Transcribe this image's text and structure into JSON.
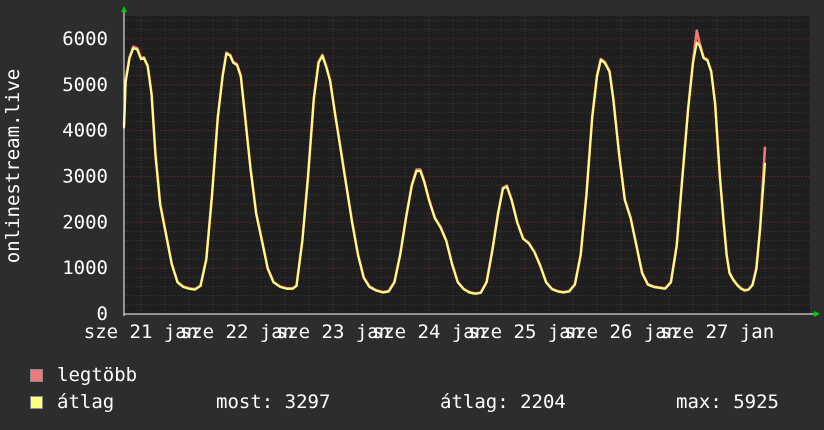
{
  "colors": {
    "background": "#2d2d2d",
    "plot_bg": "#1e1e1e",
    "grid_minor": "#3c3c3c",
    "grid_major": "#7a2a2a",
    "axis": "#ffffff",
    "max_series": "#f07878",
    "avg_series": "#fdfd80",
    "arrow": "#00cc00"
  },
  "chart_data": {
    "type": "line",
    "ylabel": "onlinestream.live",
    "ylim": [
      0,
      6500
    ],
    "y_ticks": [
      0,
      1000,
      2000,
      3000,
      4000,
      5000,
      6000
    ],
    "x_tick_labels": [
      {
        "label": "sze 21 jan",
        "day": 0
      },
      {
        "label": "sze 22 jan",
        "day": 1
      },
      {
        "label": "sze 23 jan",
        "day": 2
      },
      {
        "label": "sze 24 jan",
        "day": 3
      },
      {
        "label": "sze 25 jan",
        "day": 4
      },
      {
        "label": "sze 26 jan",
        "day": 5
      },
      {
        "label": "sze 27 jan",
        "day": 6
      }
    ],
    "x_range_days": [
      -0.2,
      6.13
    ],
    "series": [
      {
        "name": "legtöbb",
        "color": "#f07878",
        "points": [
          [
            -0.2,
            4100
          ],
          [
            -0.16,
            5100
          ],
          [
            -0.12,
            5600
          ],
          [
            -0.08,
            5830
          ],
          [
            -0.04,
            5800
          ],
          [
            0.0,
            5580
          ],
          [
            0.03,
            5600
          ],
          [
            0.07,
            5420
          ],
          [
            0.11,
            4800
          ],
          [
            0.15,
            3500
          ],
          [
            0.2,
            2400
          ],
          [
            0.26,
            1750
          ],
          [
            0.32,
            1100
          ],
          [
            0.38,
            700
          ],
          [
            0.44,
            600
          ],
          [
            0.5,
            560
          ],
          [
            0.56,
            540
          ],
          [
            0.62,
            620
          ],
          [
            0.68,
            1200
          ],
          [
            0.74,
            2600
          ],
          [
            0.8,
            4300
          ],
          [
            0.85,
            5200
          ],
          [
            0.89,
            5700
          ],
          [
            0.93,
            5650
          ],
          [
            0.96,
            5500
          ],
          [
            1.0,
            5450
          ],
          [
            1.04,
            5200
          ],
          [
            1.08,
            4400
          ],
          [
            1.14,
            3200
          ],
          [
            1.2,
            2200
          ],
          [
            1.26,
            1600
          ],
          [
            1.32,
            1000
          ],
          [
            1.38,
            700
          ],
          [
            1.45,
            600
          ],
          [
            1.52,
            560
          ],
          [
            1.58,
            560
          ],
          [
            1.62,
            620
          ],
          [
            1.68,
            1600
          ],
          [
            1.74,
            3000
          ],
          [
            1.8,
            4700
          ],
          [
            1.85,
            5500
          ],
          [
            1.89,
            5650
          ],
          [
            1.93,
            5400
          ],
          [
            1.97,
            5100
          ],
          [
            2.02,
            4400
          ],
          [
            2.08,
            3600
          ],
          [
            2.14,
            2800
          ],
          [
            2.2,
            2000
          ],
          [
            2.26,
            1300
          ],
          [
            2.32,
            800
          ],
          [
            2.38,
            600
          ],
          [
            2.45,
            520
          ],
          [
            2.52,
            480
          ],
          [
            2.58,
            500
          ],
          [
            2.64,
            700
          ],
          [
            2.7,
            1300
          ],
          [
            2.76,
            2100
          ],
          [
            2.82,
            2800
          ],
          [
            2.87,
            3150
          ],
          [
            2.91,
            3150
          ],
          [
            2.95,
            2900
          ],
          [
            3.0,
            2500
          ],
          [
            3.06,
            2100
          ],
          [
            3.12,
            1900
          ],
          [
            3.18,
            1600
          ],
          [
            3.24,
            1100
          ],
          [
            3.3,
            700
          ],
          [
            3.36,
            550
          ],
          [
            3.42,
            480
          ],
          [
            3.48,
            450
          ],
          [
            3.54,
            470
          ],
          [
            3.6,
            700
          ],
          [
            3.66,
            1400
          ],
          [
            3.72,
            2200
          ],
          [
            3.77,
            2750
          ],
          [
            3.81,
            2800
          ],
          [
            3.86,
            2500
          ],
          [
            3.92,
            2000
          ],
          [
            3.98,
            1650
          ],
          [
            4.04,
            1550
          ],
          [
            4.1,
            1350
          ],
          [
            4.16,
            1050
          ],
          [
            4.22,
            700
          ],
          [
            4.28,
            550
          ],
          [
            4.34,
            500
          ],
          [
            4.4,
            480
          ],
          [
            4.46,
            500
          ],
          [
            4.52,
            650
          ],
          [
            4.58,
            1300
          ],
          [
            4.64,
            2600
          ],
          [
            4.7,
            4300
          ],
          [
            4.75,
            5200
          ],
          [
            4.79,
            5560
          ],
          [
            4.83,
            5500
          ],
          [
            4.88,
            5300
          ],
          [
            4.92,
            4700
          ],
          [
            4.98,
            3500
          ],
          [
            5.04,
            2500
          ],
          [
            5.1,
            2100
          ],
          [
            5.16,
            1500
          ],
          [
            5.22,
            900
          ],
          [
            5.28,
            650
          ],
          [
            5.34,
            600
          ],
          [
            5.4,
            580
          ],
          [
            5.46,
            560
          ],
          [
            5.52,
            700
          ],
          [
            5.58,
            1500
          ],
          [
            5.64,
            3000
          ],
          [
            5.7,
            4500
          ],
          [
            5.75,
            5500
          ],
          [
            5.79,
            6180
          ],
          [
            5.82,
            5900
          ],
          [
            5.86,
            5600
          ],
          [
            5.9,
            5550
          ],
          [
            5.94,
            5300
          ],
          [
            5.98,
            4600
          ],
          [
            6.03,
            3000
          ],
          [
            6.07,
            2000
          ],
          [
            6.1,
            1300
          ],
          [
            6.13,
            900
          ],
          [
            6.17,
            750
          ],
          [
            6.21,
            640
          ],
          [
            6.25,
            560
          ],
          [
            6.29,
            520
          ],
          [
            6.33,
            540
          ],
          [
            6.37,
            640
          ],
          [
            6.41,
            1000
          ],
          [
            6.45,
            1900
          ],
          [
            6.5,
            3650
          ]
        ]
      },
      {
        "name": "átlag",
        "color": "#fdfd80",
        "points": [
          [
            -0.2,
            4050
          ],
          [
            -0.16,
            5050
          ],
          [
            -0.12,
            5580
          ],
          [
            -0.08,
            5800
          ],
          [
            -0.04,
            5770
          ],
          [
            0.0,
            5560
          ],
          [
            0.03,
            5580
          ],
          [
            0.07,
            5400
          ],
          [
            0.11,
            4780
          ],
          [
            0.15,
            3480
          ],
          [
            0.2,
            2380
          ],
          [
            0.26,
            1730
          ],
          [
            0.32,
            1090
          ],
          [
            0.38,
            690
          ],
          [
            0.44,
            590
          ],
          [
            0.5,
            550
          ],
          [
            0.56,
            530
          ],
          [
            0.62,
            610
          ],
          [
            0.68,
            1180
          ],
          [
            0.74,
            2580
          ],
          [
            0.8,
            4280
          ],
          [
            0.85,
            5180
          ],
          [
            0.89,
            5680
          ],
          [
            0.93,
            5630
          ],
          [
            0.96,
            5480
          ],
          [
            1.0,
            5430
          ],
          [
            1.04,
            5180
          ],
          [
            1.08,
            4380
          ],
          [
            1.14,
            3180
          ],
          [
            1.2,
            2180
          ],
          [
            1.26,
            1590
          ],
          [
            1.32,
            990
          ],
          [
            1.38,
            690
          ],
          [
            1.45,
            590
          ],
          [
            1.52,
            550
          ],
          [
            1.58,
            550
          ],
          [
            1.62,
            610
          ],
          [
            1.68,
            1580
          ],
          [
            1.74,
            2980
          ],
          [
            1.8,
            4680
          ],
          [
            1.85,
            5480
          ],
          [
            1.89,
            5630
          ],
          [
            1.93,
            5380
          ],
          [
            1.97,
            5080
          ],
          [
            2.02,
            4380
          ],
          [
            2.08,
            3580
          ],
          [
            2.14,
            2780
          ],
          [
            2.2,
            1980
          ],
          [
            2.26,
            1290
          ],
          [
            2.32,
            790
          ],
          [
            2.38,
            590
          ],
          [
            2.45,
            510
          ],
          [
            2.52,
            470
          ],
          [
            2.58,
            490
          ],
          [
            2.64,
            690
          ],
          [
            2.7,
            1290
          ],
          [
            2.76,
            2090
          ],
          [
            2.82,
            2790
          ],
          [
            2.87,
            3120
          ],
          [
            2.91,
            3120
          ],
          [
            2.95,
            2880
          ],
          [
            3.0,
            2480
          ],
          [
            3.06,
            2090
          ],
          [
            3.12,
            1890
          ],
          [
            3.18,
            1590
          ],
          [
            3.24,
            1090
          ],
          [
            3.3,
            690
          ],
          [
            3.36,
            540
          ],
          [
            3.42,
            470
          ],
          [
            3.48,
            440
          ],
          [
            3.54,
            460
          ],
          [
            3.6,
            690
          ],
          [
            3.66,
            1390
          ],
          [
            3.72,
            2190
          ],
          [
            3.77,
            2730
          ],
          [
            3.81,
            2780
          ],
          [
            3.86,
            2480
          ],
          [
            3.92,
            1990
          ],
          [
            3.98,
            1640
          ],
          [
            4.04,
            1540
          ],
          [
            4.1,
            1340
          ],
          [
            4.16,
            1040
          ],
          [
            4.22,
            690
          ],
          [
            4.28,
            540
          ],
          [
            4.34,
            490
          ],
          [
            4.4,
            470
          ],
          [
            4.46,
            490
          ],
          [
            4.52,
            640
          ],
          [
            4.58,
            1290
          ],
          [
            4.64,
            2580
          ],
          [
            4.7,
            4280
          ],
          [
            4.75,
            5180
          ],
          [
            4.79,
            5540
          ],
          [
            4.83,
            5480
          ],
          [
            4.88,
            5280
          ],
          [
            4.92,
            4680
          ],
          [
            4.98,
            3480
          ],
          [
            5.04,
            2480
          ],
          [
            5.1,
            2090
          ],
          [
            5.16,
            1490
          ],
          [
            5.22,
            890
          ],
          [
            5.28,
            640
          ],
          [
            5.34,
            590
          ],
          [
            5.4,
            570
          ],
          [
            5.46,
            550
          ],
          [
            5.52,
            690
          ],
          [
            5.58,
            1480
          ],
          [
            5.64,
            2980
          ],
          [
            5.7,
            4480
          ],
          [
            5.75,
            5480
          ],
          [
            5.79,
            5920
          ],
          [
            5.82,
            5850
          ],
          [
            5.86,
            5580
          ],
          [
            5.9,
            5530
          ],
          [
            5.94,
            5280
          ],
          [
            5.98,
            4580
          ],
          [
            6.03,
            2980
          ],
          [
            6.07,
            1990
          ],
          [
            6.1,
            1290
          ],
          [
            6.13,
            890
          ],
          [
            6.17,
            740
          ],
          [
            6.21,
            630
          ],
          [
            6.25,
            550
          ],
          [
            6.29,
            510
          ],
          [
            6.33,
            530
          ],
          [
            6.37,
            630
          ],
          [
            6.41,
            990
          ],
          [
            6.45,
            1880
          ],
          [
            6.5,
            3297
          ]
        ]
      }
    ],
    "grid": true
  },
  "legend": {
    "max_label": "legtöbb",
    "avg_label": "átlag",
    "now_text": "most: 3297",
    "average_text": "átlag: 2204",
    "max_text": "max: 5925"
  }
}
